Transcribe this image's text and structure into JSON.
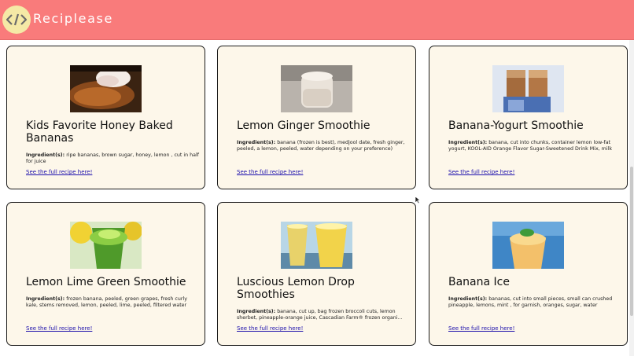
{
  "header": {
    "brand": "Reciplease",
    "background_color": "#f97b7b",
    "logo_icon": "code-icon"
  },
  "recipes": [
    {
      "title": "Kids Favorite Honey Baked Bananas",
      "ingredients_label": "Ingredient(s):",
      "ingredients": "ripe bananas, brown sugar, honey, lemon , cut in half for juice",
      "link": "See the full recipe here!"
    },
    {
      "title": "Lemon Ginger Smoothie",
      "ingredients_label": "Ingredient(s):",
      "ingredients": "banana (frozen is best), medjool date, fresh ginger, peeled, a lemon, peeled, water depending on your preference)",
      "link": "See the full recipe here!"
    },
    {
      "title": "Banana-Yogurt Smoothie",
      "ingredients_label": "Ingredient(s):",
      "ingredients": "banana, cut into chunks, container lemon low-fat yogurt, KOOL-AID Orange Flavor Sugar-Sweetened Drink Mix, milk",
      "link": "See the full recipe here!"
    },
    {
      "title": "Lemon Lime Green Smoothie",
      "ingredients_label": "Ingredient(s):",
      "ingredients": "frozen banana, peeled, green grapes, fresh curly kale, stems removed, lemon, peeled, lime, peeled, filtered water",
      "link": "See the full recipe here!"
    },
    {
      "title": "Luscious Lemon Drop Smoothies",
      "ingredients_label": "Ingredient(s):",
      "ingredients": "banana, cut up, bag frozen broccoli cuts, lemon sherbet, pineapple-orange juice, Cascadian Farm® frozen organi…",
      "link": "See the full recipe here!"
    },
    {
      "title": "Banana Ice",
      "ingredients_label": "Ingredient(s):",
      "ingredients": "bananas, cut into small pieces, small can crushed pineapple, lemons, mint , for garnish, oranges, sugar, water",
      "link": "See the full recipe here!"
    }
  ]
}
